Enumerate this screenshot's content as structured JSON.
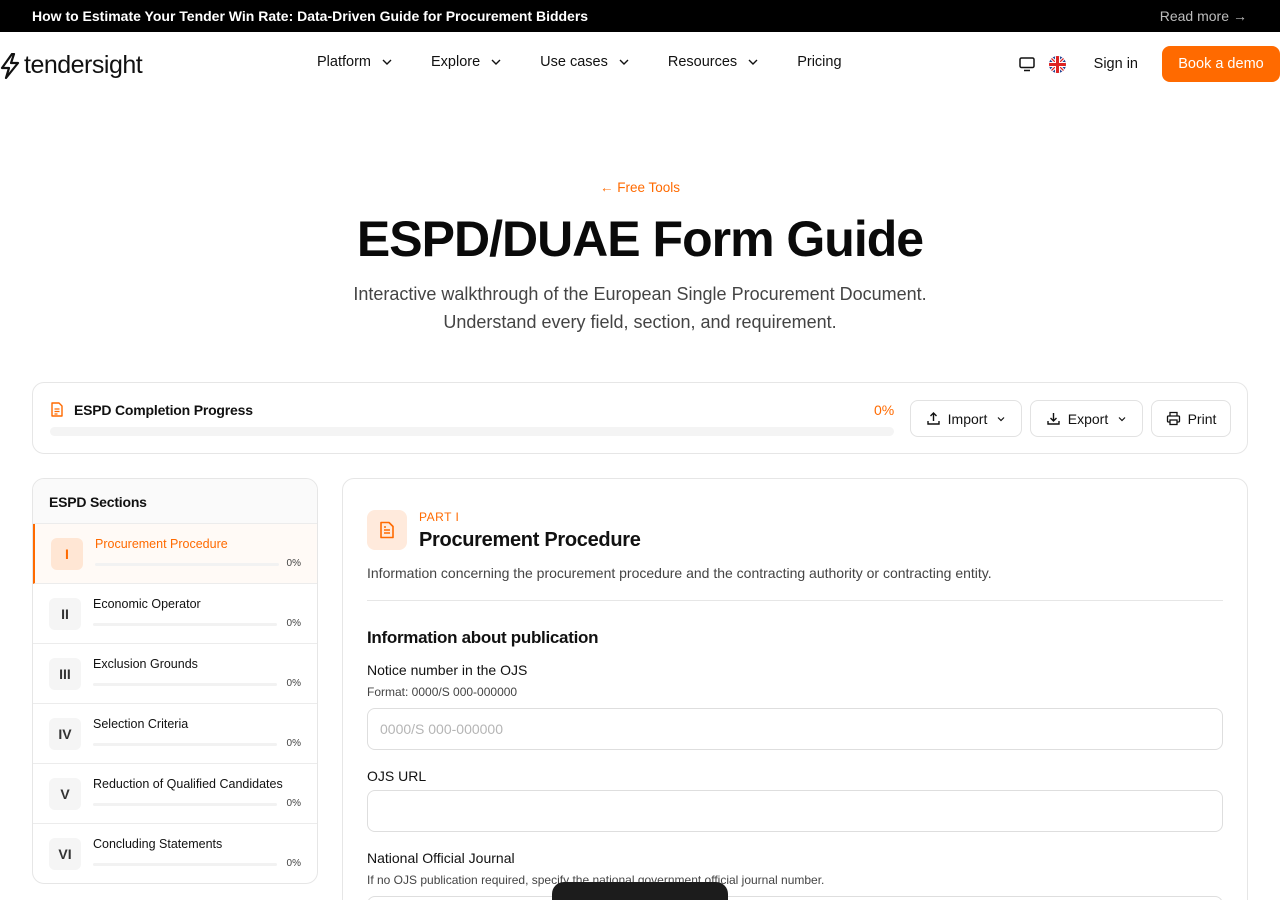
{
  "announcement": {
    "message": "How to Estimate Your Tender Win Rate: Data-Driven Guide for Procurement Bidders",
    "read_more": "Read more",
    "arrow": "→"
  },
  "header": {
    "logo_text": "tendersight",
    "nav": [
      {
        "label": "Platform",
        "has_dropdown": true
      },
      {
        "label": "Explore",
        "has_dropdown": true
      },
      {
        "label": "Use cases",
        "has_dropdown": true
      },
      {
        "label": "Resources",
        "has_dropdown": true
      },
      {
        "label": "Pricing",
        "has_dropdown": false
      }
    ],
    "sign_in": "Sign in",
    "book_demo": "Book a demo",
    "icons": [
      "monitor-icon",
      "uk-flag-icon"
    ]
  },
  "hero": {
    "back_link": "← Free Tools",
    "title": "ESPD/DUAE Form Guide",
    "subtitle_line1": "Interactive walkthrough of the European Single Procurement Document.",
    "subtitle_line2": "Understand every field, section, and requirement."
  },
  "progress": {
    "title": "ESPD Completion Progress",
    "percent_text": "0%",
    "percent": 0,
    "import_label": "Import",
    "export_label": "Export",
    "print_label": "Print"
  },
  "sidebar": {
    "title": "ESPD Sections",
    "items": [
      {
        "num": "I",
        "label": "Procurement Procedure",
        "pct_text": "0%",
        "active": true
      },
      {
        "num": "II",
        "label": "Economic Operator",
        "pct_text": "0%",
        "active": false
      },
      {
        "num": "III",
        "label": "Exclusion Grounds",
        "pct_text": "0%",
        "active": false
      },
      {
        "num": "IV",
        "label": "Selection Criteria",
        "pct_text": "0%",
        "active": false
      },
      {
        "num": "V",
        "label": "Reduction of Qualified Candidates",
        "pct_text": "0%",
        "active": false
      },
      {
        "num": "VI",
        "label": "Concluding Statements",
        "pct_text": "0%",
        "active": false
      }
    ]
  },
  "main": {
    "part_label": "PART I",
    "part_title": "Procurement Procedure",
    "part_desc": "Information concerning the procurement procedure and the contracting authority or contracting entity.",
    "section_title": "Information about publication",
    "fields": [
      {
        "label": "Notice number in the OJS",
        "help": "Format: 0000/S 000-000000",
        "value": "",
        "placeholder": "0000/S 000-000000"
      },
      {
        "label": "OJS URL",
        "help": "",
        "value": "",
        "placeholder": ""
      },
      {
        "label": "National Official Journal",
        "help": "If no OJS publication required, specify the national government official journal number.",
        "value": "",
        "placeholder": ""
      }
    ]
  },
  "colors": {
    "accent": "#ff6a00",
    "announcement_bg": "#000000",
    "border": "#e6e6e6"
  }
}
